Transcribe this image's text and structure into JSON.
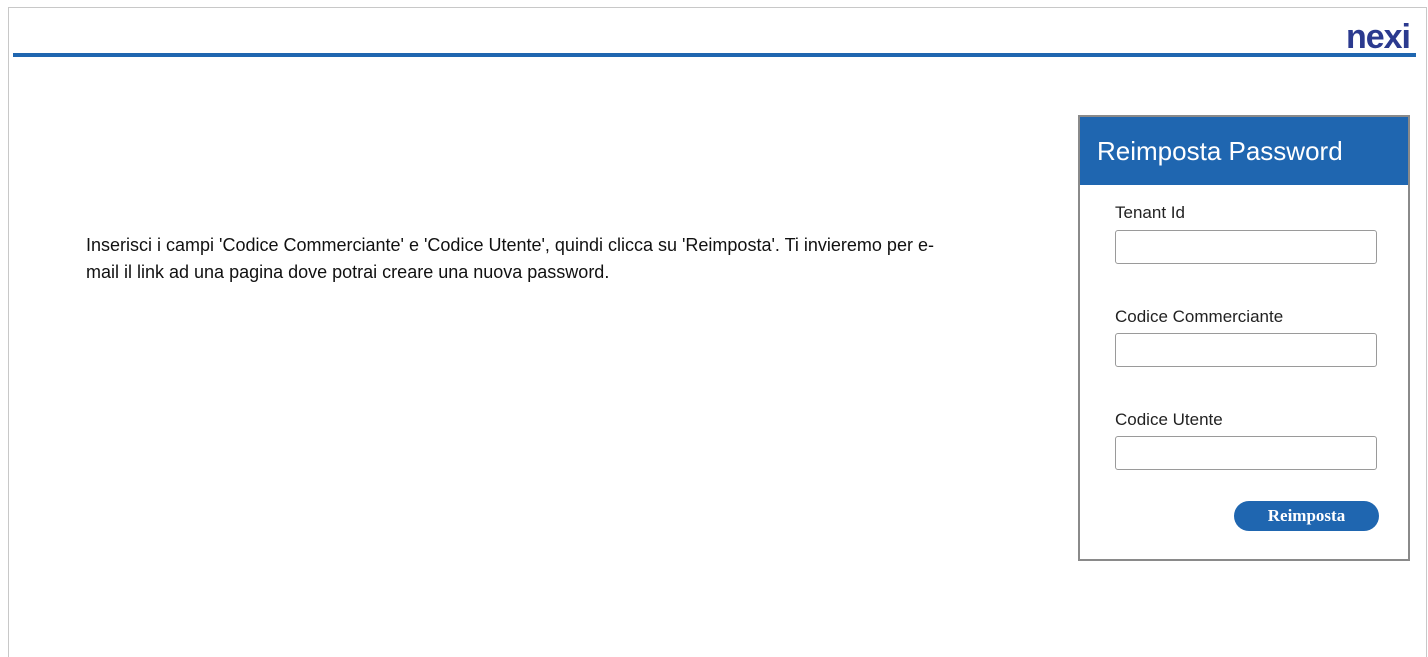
{
  "brand": {
    "logo_text": "nexi",
    "colors": {
      "primary": "#1f66b0",
      "logo": "#2b3a8f"
    }
  },
  "intro": {
    "text": "Inserisci i campi 'Codice Commerciante' e 'Codice Utente', quindi clicca su 'Reimposta'. Ti invieremo per e-mail il link ad una pagina dove potrai creare una nuova password."
  },
  "form": {
    "title": "Reimposta Password",
    "fields": [
      {
        "label": "Tenant Id",
        "value": ""
      },
      {
        "label": "Codice Commerciante",
        "value": ""
      },
      {
        "label": "Codice Utente",
        "value": ""
      }
    ],
    "submit_label": "Reimposta"
  }
}
